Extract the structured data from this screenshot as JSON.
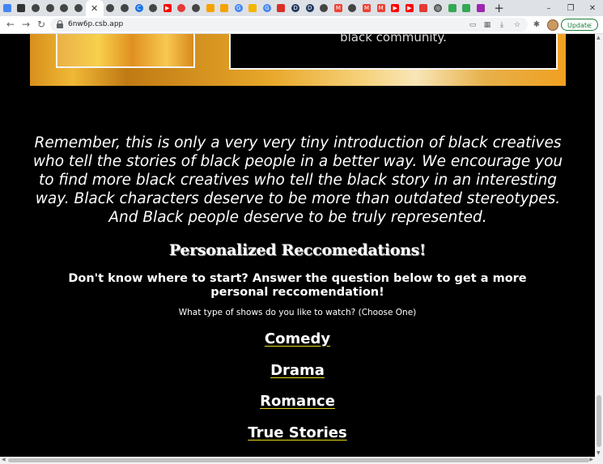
{
  "browser": {
    "tabs": [
      {
        "icon": "docs-icon",
        "color": "#4285f4"
      },
      {
        "icon": "notion-icon",
        "color": "#333333"
      },
      {
        "icon": "codesandbox-icon",
        "color": "#444444"
      },
      {
        "icon": "codesandbox-icon",
        "color": "#444444"
      },
      {
        "icon": "codesandbox-icon",
        "color": "#444444"
      },
      {
        "icon": "codesandbox-icon",
        "color": "#444444"
      },
      {
        "icon": "close-icon",
        "color": "#333333",
        "active": true
      },
      {
        "icon": "codesandbox-icon",
        "color": "#444444"
      },
      {
        "icon": "codesandbox-icon",
        "color": "#444444"
      },
      {
        "icon": "c-icon",
        "color": "#1a73e8"
      },
      {
        "icon": "codesandbox-icon",
        "color": "#444444"
      },
      {
        "icon": "youtube-icon",
        "color": "#ff0000"
      },
      {
        "icon": "red-circle-icon",
        "color": "#e53935"
      },
      {
        "icon": "codesandbox-icon",
        "color": "#444444"
      },
      {
        "icon": "flame-icon",
        "color": "#f4a300"
      },
      {
        "icon": "flame-icon",
        "color": "#f4a300"
      },
      {
        "icon": "google-icon",
        "color": "#4285f4"
      },
      {
        "icon": "slides-icon",
        "color": "#f4b400"
      },
      {
        "icon": "google-icon",
        "color": "#4285f4"
      },
      {
        "icon": "calendar-icon",
        "color": "#d93025"
      },
      {
        "icon": "d-icon",
        "color": "#1f3a5f"
      },
      {
        "icon": "d-icon",
        "color": "#1f3a5f"
      },
      {
        "icon": "codesandbox-icon",
        "color": "#444444"
      },
      {
        "icon": "gmail-icon",
        "color": "#ea4335"
      },
      {
        "icon": "codesandbox-icon",
        "color": "#444444"
      },
      {
        "icon": "gmail-icon",
        "color": "#ea4335"
      },
      {
        "icon": "gmail-icon",
        "color": "#ea4335"
      },
      {
        "icon": "youtube-icon",
        "color": "#ff0000"
      },
      {
        "icon": "youtube-icon",
        "color": "#ff0000"
      },
      {
        "icon": "bookmark-icon",
        "color": "#e53935"
      },
      {
        "icon": "globe-icon",
        "color": "#555555"
      },
      {
        "icon": "drive-icon",
        "color": "#34a853"
      },
      {
        "icon": "drive-icon",
        "color": "#34a853"
      },
      {
        "icon": "pinwheel-icon",
        "color": "#9c27b0"
      }
    ],
    "new_tab_glyph": "+",
    "minimize_glyph": "–",
    "restore_glyph": "❐",
    "close_window_glyph": "✕",
    "url": "6nw6p.csb.app",
    "update_label": "Update",
    "update_dots": "⋮"
  },
  "page": {
    "banner_caption": "black community.",
    "intro": "Remember, this is only a very very tiny introduction of black creatives who tell the stories of black people in a better way. We encourage you to find more black creatives who tell the black story in an interesting way. Black characters deserve to be more than outdated stereotypes. And Black people deserve to be truly represented.",
    "rec_heading": "Personalized Reccomedations!",
    "rec_sub": "Don't know where to start? Answer the question below to get a more personal reccomendation!",
    "question": "What type of shows do you like to watch? (Choose One)",
    "options": [
      "Comedy",
      "Drama",
      "Romance",
      "True Stories"
    ]
  },
  "colors": {
    "background": "#000000",
    "text": "#ffffff",
    "link_underline": "#e8d820",
    "banner_gold": "#e8a82a"
  }
}
